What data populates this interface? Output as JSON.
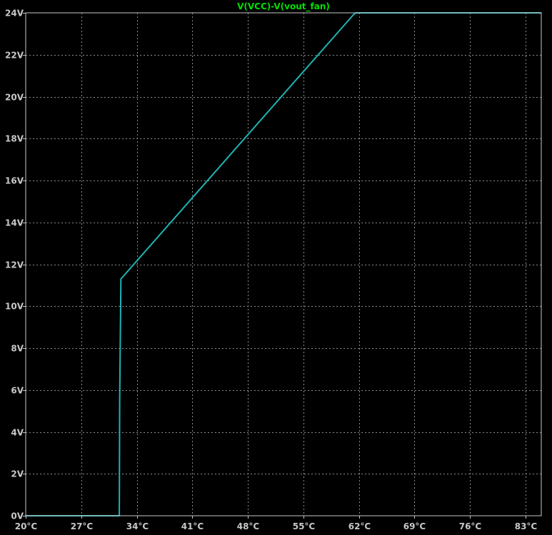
{
  "chart_data": {
    "type": "line",
    "title": "V(VCC)-V(vout_fan)",
    "xlabel": "",
    "ylabel": "",
    "xlim": [
      20,
      85
    ],
    "ylim": [
      0,
      24
    ],
    "x_ticks": [
      20,
      27,
      34,
      41,
      48,
      55,
      62,
      69,
      76,
      83
    ],
    "x_tick_labels": [
      "20°C",
      "27°C",
      "34°C",
      "41°C",
      "48°C",
      "55°C",
      "62°C",
      "69°C",
      "76°C",
      "83°C"
    ],
    "y_ticks": [
      0,
      2,
      4,
      6,
      8,
      10,
      12,
      14,
      16,
      18,
      20,
      22,
      24
    ],
    "y_tick_labels": [
      "0V",
      "2V",
      "4V",
      "6V",
      "8V",
      "10V",
      "12V",
      "14V",
      "16V",
      "18V",
      "20V",
      "22V",
      "24V"
    ],
    "grid": true,
    "colors": {
      "background": "#000000",
      "series": "#1fb3b3",
      "grid": "#8c8c8c",
      "axis": "#c8c8c8",
      "title": "#00e000"
    },
    "series": [
      {
        "name": "V(VCC)-V(vout_fan)",
        "x": [
          20,
          31.8,
          31.85,
          32.0,
          61.3,
          61.6,
          85
        ],
        "y": [
          0,
          0,
          5.5,
          11.3,
          23.9,
          24.0,
          24.0
        ]
      }
    ]
  }
}
